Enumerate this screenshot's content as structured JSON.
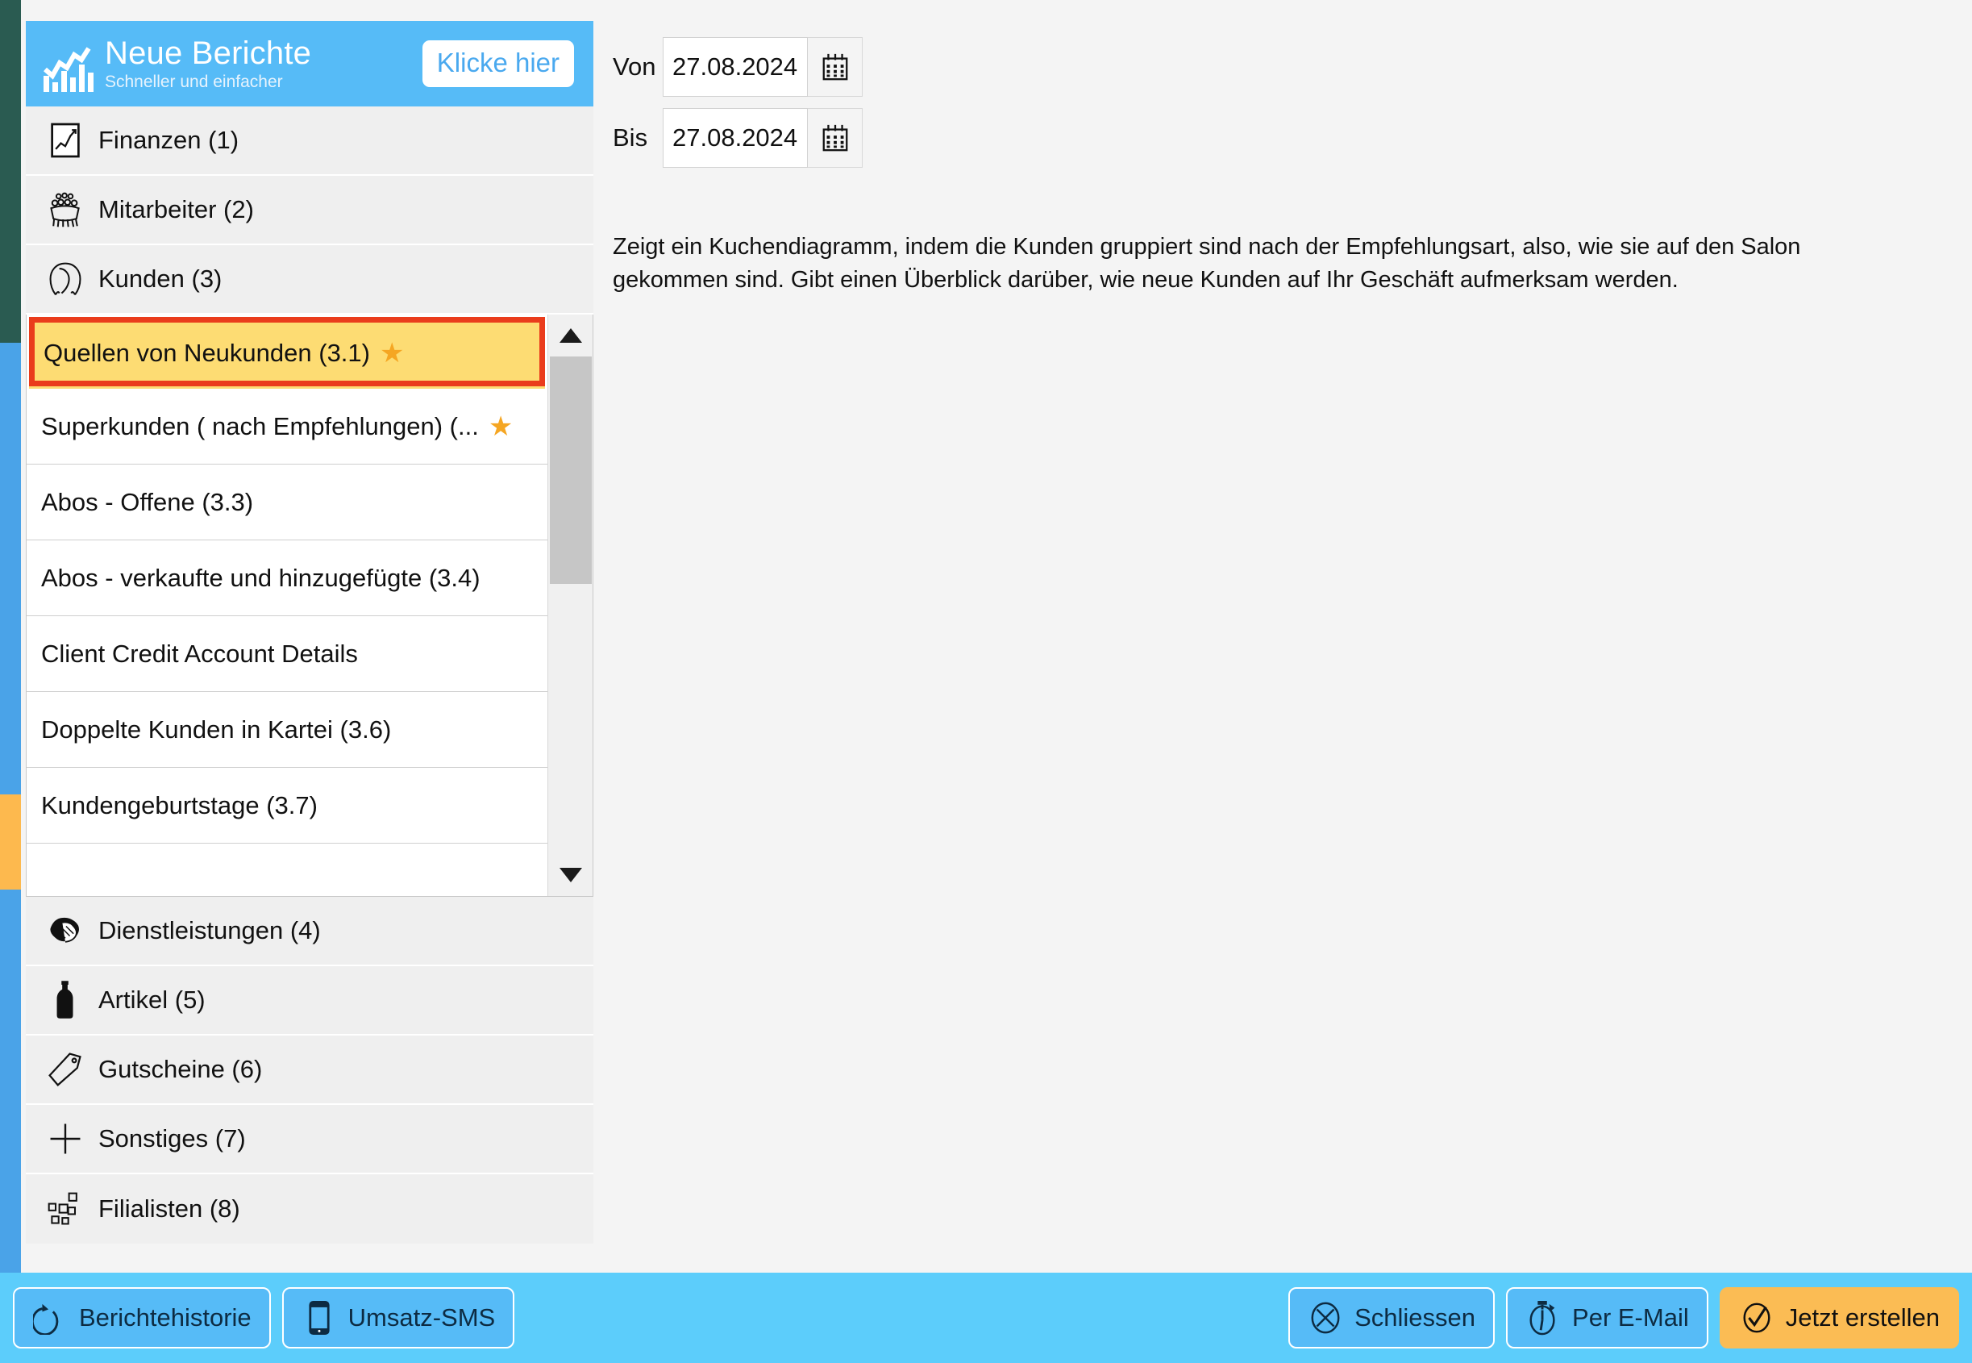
{
  "edge_strip": {
    "segments": [
      {
        "name": "teal",
        "color": "#2a5b51"
      },
      {
        "name": "blue",
        "color": "#4aa3e8"
      },
      {
        "name": "orange",
        "color": "#fdb94e"
      },
      {
        "name": "blue",
        "color": "#4aa3e8"
      }
    ]
  },
  "promo": {
    "title": "Neue Berichte",
    "subtitle": "Schneller und einfacher",
    "cta": "Klicke hier",
    "icon": "bar-chart-trend-icon",
    "bg_color": "#56bbf7",
    "cta_text_color": "#4aa9ef"
  },
  "sidebar": {
    "categories_top": [
      {
        "label": "Finanzen (1)",
        "icon": "line-chart-icon"
      },
      {
        "label": "Mitarbeiter (2)",
        "icon": "staff-group-icon"
      },
      {
        "label": "Kunden (3)",
        "icon": "client-head-icon"
      }
    ],
    "categories_bottom": [
      {
        "label": "Dienstleistungen (4)",
        "icon": "hand-service-icon"
      },
      {
        "label": "Artikel (5)",
        "icon": "bottle-icon"
      },
      {
        "label": "Gutscheine (6)",
        "icon": "tag-icon"
      },
      {
        "label": "Sonstiges (7)",
        "icon": "plus-icon"
      },
      {
        "label": "Filialisten (8)",
        "icon": "network-nodes-icon"
      }
    ],
    "sublist": {
      "selected_index": 0,
      "selection_bg": "#fddc73",
      "selection_outline": "#ea3c1c",
      "star_color": "#f5a623",
      "items": [
        {
          "label": "Quellen von Neukunden (3.1)",
          "starred": true
        },
        {
          "label": "Superkunden ( nach Empfehlungen) (...",
          "starred": true
        },
        {
          "label": "Abos - Offene (3.3)",
          "starred": false
        },
        {
          "label": "Abos - verkaufte und hinzugefügte  (3.4)",
          "starred": false
        },
        {
          "label": "Client Credit Account Details",
          "starred": false
        },
        {
          "label": "Doppelte Kunden in Kartei (3.6)",
          "starred": false
        },
        {
          "label": "Kundengeburtstage (3.7)",
          "starred": false
        },
        {
          "label": "",
          "starred": false
        }
      ],
      "scroll_up_icon": "triangle-up-icon",
      "scroll_down_icon": "triangle-down-icon"
    }
  },
  "filters": {
    "from": {
      "label": "Von",
      "value": "27.08.2024",
      "calendar_icon": "calendar-icon"
    },
    "to": {
      "label": "Bis",
      "value": "27.08.2024",
      "calendar_icon": "calendar-icon"
    }
  },
  "description": "Zeigt ein Kuchendiagramm, indem die Kunden gruppiert sind nach der Empfehlungsart, also, wie sie auf den Salon gekommen sind. Gibt einen Überblick darüber, wie neue Kunden auf Ihr Geschäft aufmerksam werden.",
  "bottom_bar": {
    "bg_color": "#5ccdfb",
    "left_buttons": [
      {
        "label": "Berichtehistorie",
        "icon": "undo-arrow-icon"
      },
      {
        "label": "Umsatz-SMS",
        "icon": "mobile-phone-icon"
      }
    ],
    "right_buttons": [
      {
        "label": "Schliessen",
        "icon": "circle-x-icon",
        "primary": false
      },
      {
        "label": "Per E-Mail",
        "icon": "stopwatch-icon",
        "primary": false
      },
      {
        "label": "Jetzt erstellen",
        "icon": "circle-check-icon",
        "primary": true
      }
    ],
    "primary_color": "#fbbc54"
  }
}
